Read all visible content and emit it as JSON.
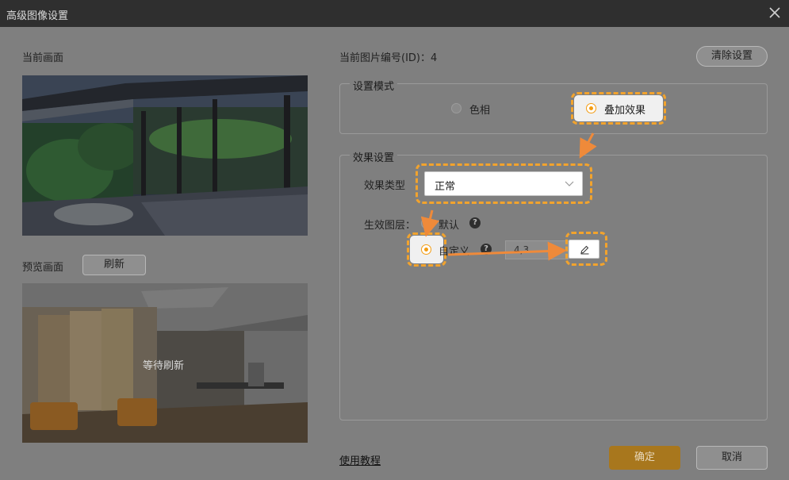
{
  "dialog": {
    "title": "高级图像设置"
  },
  "left": {
    "current_label": "当前画面",
    "preview_label": "预览画面",
    "refresh_button": "刷新",
    "preview_overlay": "等待刷新"
  },
  "right": {
    "picture_id_label": "当前图片编号(ID)：4",
    "clear_button": "清除设置",
    "mode_group": {
      "title": "设置模式",
      "options": [
        "色相",
        "叠加效果"
      ],
      "selected": "叠加效果"
    },
    "effect_group": {
      "title": "效果设置",
      "type_label": "效果类型",
      "type_value": "正常",
      "layer_label": "生效图层：",
      "layer_default": "默认",
      "layer_custom": "自定义",
      "layer_custom_value": "4,3"
    }
  },
  "footer": {
    "tutorial_link": "使用教程",
    "confirm_button": "确定",
    "cancel_button": "取消"
  },
  "colors": {
    "highlight": "#f2a32d",
    "arrow": "#ef8a3a",
    "titlebar": "#2f2f2f"
  }
}
